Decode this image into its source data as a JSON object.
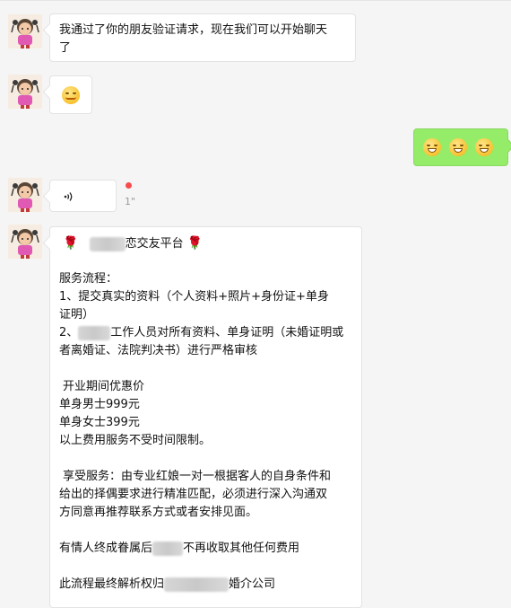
{
  "messages": {
    "m1": {
      "text_line1": "我通过了你的朋友验证请求，现在我们可以开始聊天",
      "text_line2": "了"
    },
    "m2": {
      "emoji": "smile-emoji"
    },
    "m3": {
      "emojis": [
        "grin-emoji",
        "grin-emoji",
        "grin-emoji"
      ]
    },
    "m4": {
      "voice_icon": "voice-wave-icon",
      "duration": "1\""
    },
    "m5": {
      "rose_icon": "rose-icon",
      "title": "恋交友平台",
      "lines": [
        "服务流程：",
        "1、提交真实的资料（个人资料+照片+身份证+单身",
        "证明）",
        "工作人员对所有资料、单身证明（未婚证明或",
        "者离婚证、法院判决书）进行严格审核",
        "开业期间优惠价",
        "单身男士999元",
        "单身女士399元",
        "以上费用服务不受时间限制。",
        "享受服务：由专业红娘一对一根据客人的自身条件和",
        "给出的择偶要求进行精准匹配，必须进行深入沟通双",
        "方同意再推荐联系方式或者安排见面。",
        "有情人终成眷属后",
        "不再收取其他任何费用",
        "此流程最终解析权归",
        "婚介公司"
      ],
      "line2_prefix": "2、"
    }
  },
  "colors": {
    "bg": "#f5f5f5",
    "self_bubble": "#95ec69",
    "other_bubble": "#ffffff",
    "unread_dot": "#f74c4c"
  }
}
